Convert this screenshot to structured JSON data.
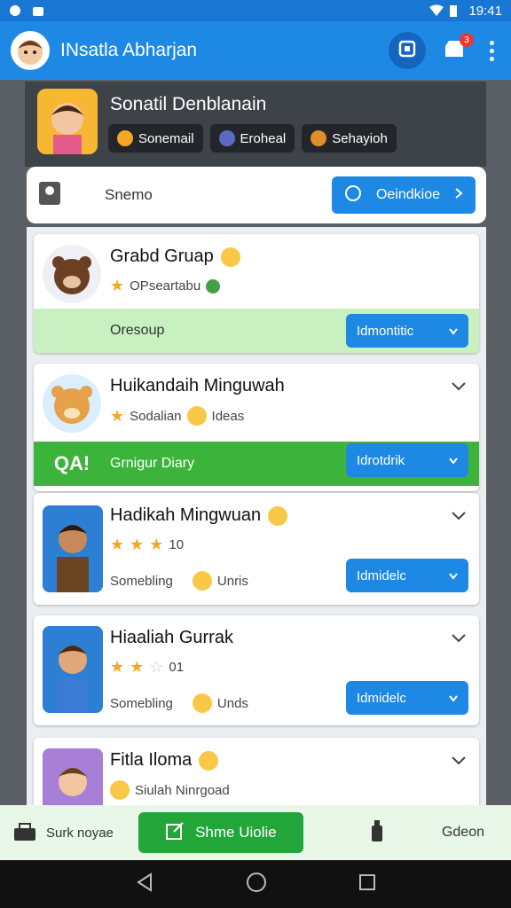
{
  "status_bar": {
    "time": "19:41"
  },
  "app_bar": {
    "title": "INsatla Abharjan",
    "badge_count": "3"
  },
  "profile": {
    "name": "Sonatil Denblanain",
    "chips": [
      "Sonemail",
      "Eroheal",
      "Sehayioh"
    ]
  },
  "search": {
    "label": "Snemo",
    "button_label": "Oeindkioe"
  },
  "cards": [
    {
      "name": "Grabd Gruap",
      "sub": "OPseartabu",
      "band_text": "Oresoup",
      "button_label": "Idmontitic"
    },
    {
      "name": "Huikandaih Minguwah",
      "sub_a": "Sodalian",
      "sub_b": "Ideas",
      "band_badge": "QA!",
      "band_text": "Grnigur Diary",
      "button_label": "Idrotdrik"
    },
    {
      "name": "Hadikah Mingwuan",
      "rating_text": "10",
      "sub_a": "Somebling",
      "sub_b": "Unris",
      "button_label": "Idmidelc"
    },
    {
      "name": "Hiaaliah Gurrak",
      "rating_text": "01",
      "sub_a": "Somebling",
      "sub_b": "Unds",
      "button_label": "Idmidelc"
    },
    {
      "name": "Fitla Iloma",
      "sub": "Siulah Ninrgoad"
    }
  ],
  "bottom_bar": {
    "left_label": "Surk noyae",
    "share_label": "Shme Uiolie",
    "right_label": "Gdeon"
  },
  "colors": {
    "primary": "#1e88e5",
    "green": "#22a539",
    "band_light": "#c8f0c0",
    "band_dark": "#3cb43c"
  }
}
